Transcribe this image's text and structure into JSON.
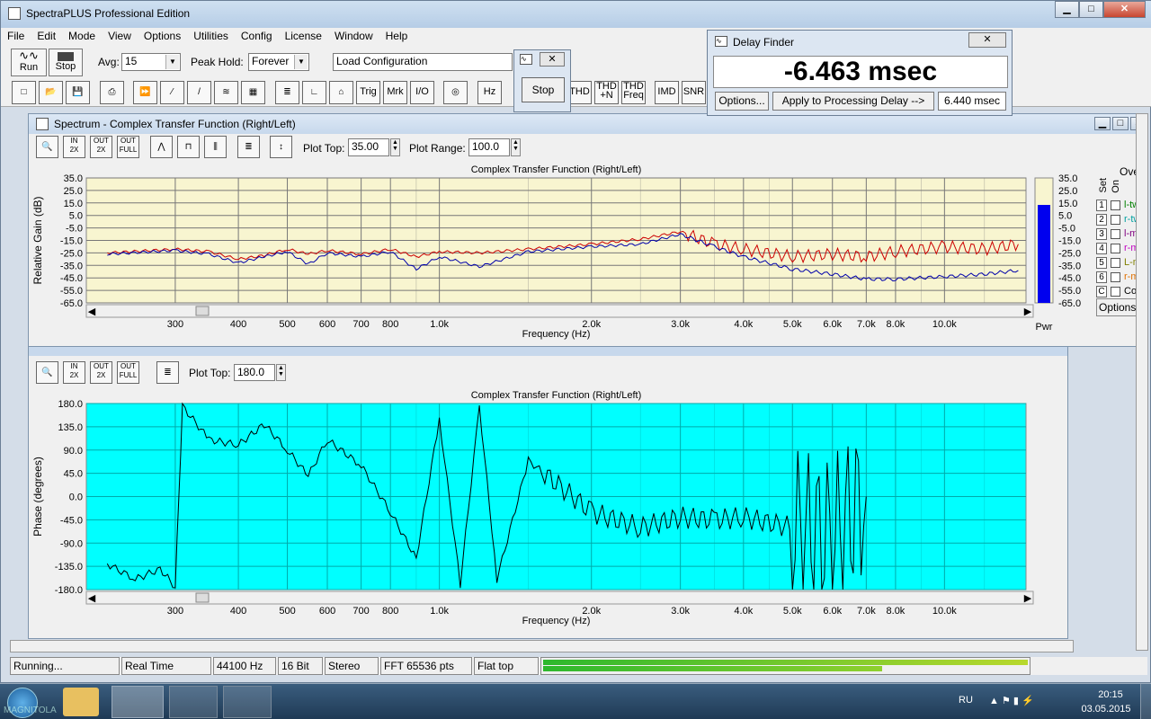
{
  "app": {
    "title": "SpectraPLUS Professional Edition"
  },
  "menu": [
    "File",
    "Edit",
    "Mode",
    "View",
    "Options",
    "Utilities",
    "Config",
    "License",
    "Window",
    "Help"
  ],
  "toolbar1": {
    "run": "Run",
    "stop": "Stop",
    "avg_label": "Avg:",
    "avg_value": "15",
    "peak_label": "Peak Hold:",
    "peak_value": "Forever",
    "load_config": "Load Configuration"
  },
  "toolbar2": {
    "trig": "Trig",
    "mrk": "Mrk",
    "io": "I/O",
    "hz": "Hz",
    "thd": "THD",
    "thdn": "THD\n+N",
    "thdfreq": "THD\nFreq",
    "imd": "IMD",
    "snr": "SNR"
  },
  "stop_dialog": {
    "button": "Stop"
  },
  "delay_finder": {
    "title": "Delay Finder",
    "value": "-6.463 msec",
    "options": "Options...",
    "apply": "Apply to Processing Delay -->",
    "delay_value": "6.440 msec"
  },
  "spectrum": {
    "title": "Spectrum - Complex Transfer Function (Right/Left)",
    "plot_top_label": "Plot Top:",
    "plot_top": "35.00",
    "plot_range_label": "Plot Range:",
    "plot_range": "100.0",
    "chart_title": "Complex Transfer Function (Right/Left)",
    "ylabel": "Relative Gain (dB)",
    "xlabel": "Frequency (Hz)",
    "pwr": "Pwr",
    "overlay_label": "Overl",
    "set": "Set",
    "on": "On",
    "options": "Options..."
  },
  "overlays": [
    {
      "n": "1",
      "label": "l-tw",
      "color": "#008000"
    },
    {
      "n": "2",
      "label": "r-tw",
      "color": "#00a0a0"
    },
    {
      "n": "3",
      "label": "l-mi",
      "color": "#800080"
    },
    {
      "n": "4",
      "label": "r-m",
      "color": "#c000c0"
    },
    {
      "n": "5",
      "label": "L-m",
      "color": "#808000"
    },
    {
      "n": "6",
      "label": "r-m",
      "color": "#e07000"
    },
    {
      "n": "C",
      "label": "Cor",
      "color": "#000000"
    }
  ],
  "phase": {
    "plot_top_label": "Plot Top:",
    "plot_top": "180.0",
    "chart_title": "Complex Transfer Function (Right/Left)",
    "ylabel": "Phase (degrees)",
    "xlabel": "Frequency (Hz)"
  },
  "chart_data": [
    {
      "type": "line",
      "title": "Complex Transfer Function (Right/Left)",
      "xlabel": "Frequency (Hz)",
      "ylabel": "Relative Gain (dB)",
      "ylim": [
        -65,
        35
      ],
      "x_scale": "log",
      "yticks": [
        "35.0",
        "25.0",
        "15.0",
        "5.0",
        "-5.0",
        "-15.0",
        "-25.0",
        "-35.0",
        "-45.0",
        "-55.0",
        "-65.0"
      ],
      "xticks": [
        "300",
        "400",
        "500",
        "600",
        "700",
        "800",
        "1.0k",
        "2.0k",
        "3.0k",
        "4.0k",
        "5.0k",
        "6.0k",
        "7.0k",
        "8.0k",
        "10.0k"
      ],
      "pwr_ticks": [
        "35.0",
        "25.0",
        "15.0",
        "5.0",
        "-5.0",
        "-15.0",
        "-25.0",
        "-35.0",
        "-45.0",
        "-55.0",
        "-65.0"
      ],
      "series": [
        {
          "color": "#cc0000",
          "x": [
            220,
            300,
            350,
            400,
            450,
            500,
            550,
            600,
            700,
            800,
            900,
            1000,
            1200,
            1500,
            2000,
            2500,
            3000,
            3500,
            4000,
            5000,
            6000,
            7000,
            8000,
            10000,
            12000,
            14000
          ],
          "y": [
            -25,
            -22,
            -24,
            -30,
            -27,
            -22,
            -26,
            -23,
            -26,
            -22,
            -28,
            -24,
            -25,
            -22,
            -18,
            -14,
            -8,
            -18,
            -22,
            -28,
            -26,
            -28,
            -24,
            -20,
            -22,
            -18
          ]
        },
        {
          "color": "#0000aa",
          "x": [
            220,
            300,
            350,
            400,
            450,
            500,
            550,
            600,
            700,
            800,
            900,
            1000,
            1200,
            1500,
            2000,
            2500,
            3000,
            3500,
            4000,
            5000,
            6000,
            7000,
            8000,
            10000,
            12000,
            14000
          ],
          "y": [
            -26,
            -23,
            -26,
            -33,
            -28,
            -24,
            -34,
            -25,
            -28,
            -24,
            -38,
            -28,
            -36,
            -24,
            -20,
            -18,
            -10,
            -20,
            -28,
            -38,
            -42,
            -46,
            -46,
            -44,
            -42,
            -39
          ]
        }
      ]
    },
    {
      "type": "line",
      "title": "Complex Transfer Function (Right/Left)",
      "xlabel": "Frequency (Hz)",
      "ylabel": "Phase (degrees)",
      "ylim": [
        -180,
        180
      ],
      "x_scale": "log",
      "yticks": [
        "180.0",
        "135.0",
        "90.0",
        "45.0",
        "0.0",
        "-45.0",
        "-90.0",
        "-135.0",
        "-180.0"
      ],
      "xticks": [
        "300",
        "400",
        "500",
        "600",
        "700",
        "800",
        "1.0k",
        "2.0k",
        "3.0k",
        "4.0k",
        "5.0k",
        "6.0k",
        "7.0k",
        "8.0k",
        "10.0k"
      ],
      "series": [
        {
          "color": "#000000",
          "x": [
            220,
            250,
            280,
            300,
            310,
            350,
            400,
            450,
            500,
            550,
            600,
            700,
            800,
            900,
            1000,
            1100,
            1200,
            1300,
            1500,
            2000,
            2500,
            3000,
            3500,
            4000,
            5000,
            6000,
            7000
          ],
          "y": [
            -130,
            -160,
            -140,
            -175,
            175,
            110,
            100,
            140,
            90,
            40,
            110,
            60,
            -30,
            -120,
            150,
            -170,
            175,
            -160,
            70,
            -30,
            -60,
            -40,
            -45,
            -40,
            -60,
            -80,
            0
          ]
        }
      ]
    }
  ],
  "status": {
    "running": "Running...",
    "mode": "Real Time",
    "rate": "44100 Hz",
    "bits": "16 Bit",
    "channels": "Stereo",
    "fft": "FFT 65536 pts",
    "window": "Flat top"
  },
  "taskbar": {
    "lang": "RU",
    "time": "20:15",
    "date": "03.05.2015"
  },
  "watermark": "MAGNITOLA"
}
